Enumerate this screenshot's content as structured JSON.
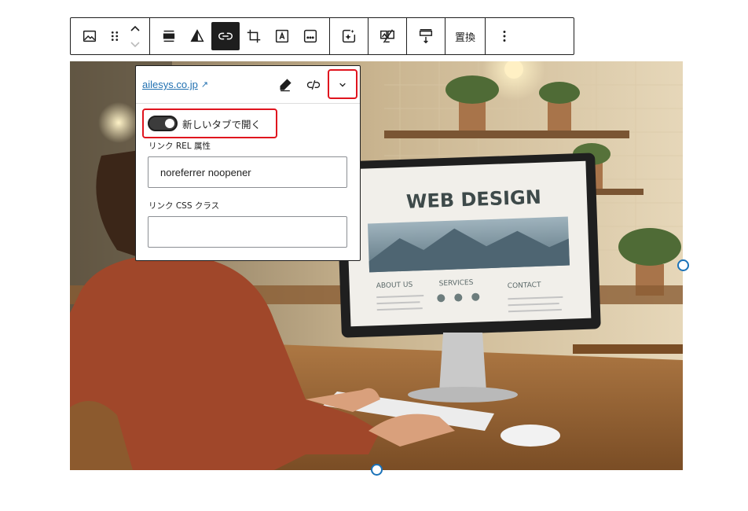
{
  "toolbar": {
    "groups": [
      {
        "items": [
          {
            "name": "image-block-icon",
            "interactable": true
          },
          {
            "name": "drag-handle-icon",
            "interactable": true
          },
          {
            "name": "move-up-icon",
            "interactable": true
          },
          {
            "name": "move-down-icon",
            "interactable": true
          }
        ]
      },
      {
        "items": [
          {
            "name": "align-icon",
            "interactable": true
          },
          {
            "name": "duotone-icon",
            "interactable": true
          },
          {
            "name": "link-icon",
            "active": true,
            "interactable": true
          },
          {
            "name": "crop-icon",
            "interactable": true
          },
          {
            "name": "text-overlay-icon",
            "interactable": true
          },
          {
            "name": "more-inline-icon",
            "interactable": true
          }
        ]
      },
      {
        "items": [
          {
            "name": "ai-image-icon",
            "interactable": true
          }
        ]
      },
      {
        "items": [
          {
            "name": "image-compare-icon",
            "interactable": true
          }
        ]
      },
      {
        "items": [
          {
            "name": "dimension-icon",
            "interactable": true
          }
        ]
      }
    ],
    "replace_label": "置換",
    "options_icon": "vertical-ellipsis-icon"
  },
  "link_popover": {
    "url_text": "ailesys.co.jp",
    "external_glyph": "↗",
    "open_in_new_tab_label": "新しいタブで開く",
    "open_in_new_tab_checked": true,
    "rel_label": "リンク REL 属性",
    "rel_value": "noreferrer noopener",
    "css_label": "リンク CSS クラス",
    "css_value": ""
  },
  "image": {
    "screen_heading": "WEB DESIGN",
    "nav_labels": [
      "ABOUT US",
      "SERVICES",
      "CONTACT"
    ]
  },
  "colors": {
    "highlight": "#e0141e",
    "link": "#2271b1",
    "handle": "#1a72b8",
    "toolbar_active_bg": "#1e1e1e"
  }
}
